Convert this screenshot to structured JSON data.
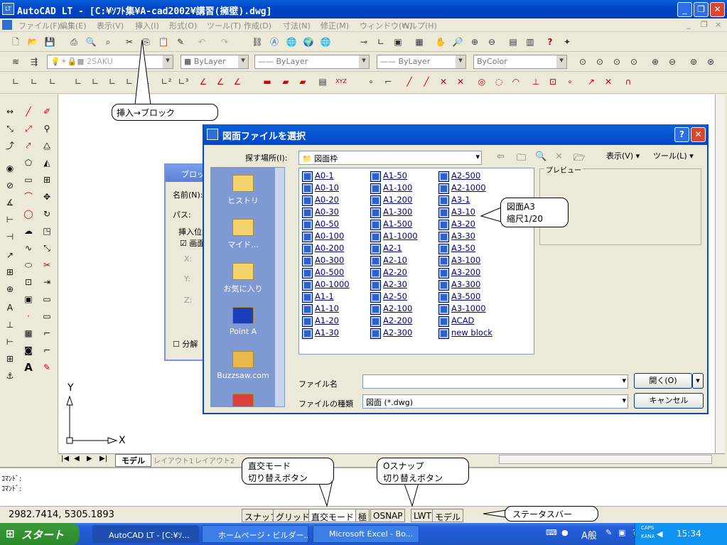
{
  "window": {
    "title": "AutoCAD LT - [C:¥ｿﾌﾄ集¥A-cad2002¥講習(擁壁).dwg]"
  },
  "menu": [
    "ファイル(F)",
    "編集(E)",
    "表示(V)",
    "挿入(I)",
    "形式(O)",
    "ツール(T)",
    "作成(D)",
    "寸法(N)",
    "修正(M)",
    "ウィンドウ(W)",
    "ヘルプ(H)"
  ],
  "toolbar": {
    "layer": "2SAKU",
    "color": "ByLayer",
    "linetype": "ByLayer",
    "lineweight": "ByLayer",
    "plotstyle": "ByColor"
  },
  "callouts": {
    "insert_block": "挿入→ブロック",
    "sheet": "図面A3\n縮尺1/20",
    "ortho": "直交モード\n切り替えボタン",
    "osnap": "Oスナップ\n切り替えボタン",
    "statusbar": "ステータスバー"
  },
  "canvas": {
    "axis_y": "Y",
    "axis_x": "X",
    "tabs": [
      "モデル",
      "レイアウト1",
      "レイアウト2"
    ]
  },
  "block_dialog": {
    "title": "ブロック挿入",
    "name_label": "名前(N):",
    "path_label": "パス:",
    "insert_label": "挿入位置",
    "onscreen_label": "画面上で指定",
    "x": "X:",
    "y": "Y:",
    "z": "Z:",
    "explode_label": "分解"
  },
  "file_dialog": {
    "title": "図面ファイルを選択",
    "lookin_label": "探す場所(I):",
    "lookin_value": "図面枠",
    "view_label": "表示(V)",
    "tools_label": "ツール(L)",
    "preview_label": "プレビュー",
    "places": [
      "ヒストリ",
      "マイド...",
      "お気に入り",
      "Point A",
      "Buzzsaw.com"
    ],
    "files": [
      [
        "A0-1",
        "A0-10",
        "A0-20",
        "A0-30",
        "A0-50",
        "A0-100",
        "A0-200",
        "A0-300",
        "A0-500",
        "A0-1000",
        "A1-1",
        "A1-10",
        "A1-20",
        "A1-30"
      ],
      [
        "A1-50",
        "A1-100",
        "A1-200",
        "A1-300",
        "A1-500",
        "A1-1000",
        "A2-1",
        "A2-10",
        "A2-20",
        "A2-30",
        "A2-50",
        "A2-100",
        "A2-200",
        "A2-300"
      ],
      [
        "A2-500",
        "A2-1000",
        "A3-1",
        "A3-10",
        "A3-20",
        "A3-30",
        "A3-50",
        "A3-100",
        "A3-200",
        "A3-300",
        "A3-500",
        "A3-1000",
        "ACAD",
        "new block"
      ]
    ],
    "filename_label": "ファイル名",
    "filename_value": "",
    "filetype_label": "ファイルの種類",
    "filetype_value": "図面 (*.dwg)",
    "open_button": "開く(O)",
    "cancel_button": "キャンセル"
  },
  "command": {
    "line1": "ｺﾏﾝﾄﾞ:",
    "line2": "ｺﾏﾝﾄﾞ:"
  },
  "status": {
    "coords": "2982.7414, 5305.1893",
    "buttons": [
      "スナップ",
      "グリッド",
      "直交モード",
      "極",
      "OSNAP",
      "LWT",
      "モデル"
    ]
  },
  "taskbar": {
    "start": "スタート",
    "tasks": [
      "AutoCAD LT - [C:¥ｿ...",
      "ホームページ・ビルダー...",
      "Microsoft Excel - Bo..."
    ],
    "ime": "A般",
    "caps": "CAPS",
    "kana": "KANA",
    "clock": "15:34"
  }
}
